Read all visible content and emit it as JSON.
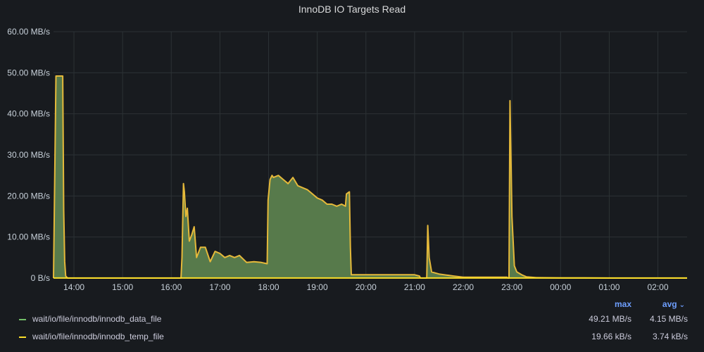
{
  "panel": {
    "title": "InnoDB IO Targets Read"
  },
  "legend": {
    "col_max": "max",
    "col_avg": "avg",
    "sort_icon": "chevron-down-icon",
    "rows": [
      {
        "name": "wait/io/file/innodb/innodb_data_file",
        "max": "49.21 MB/s",
        "avg": "4.15 MB/s",
        "color": "#73bf69"
      },
      {
        "name": "wait/io/file/innodb/innodb_temp_file",
        "max": "19.66 kB/s",
        "avg": "3.74 kB/s",
        "color": "#fade2a"
      }
    ]
  },
  "chart_data": {
    "type": "area",
    "title": "InnoDB IO Targets Read",
    "ylabel": "",
    "xlabel": "",
    "ylim": [
      0,
      60
    ],
    "y_unit": "MB/s",
    "y_ticks": [
      "0 B/s",
      "10.00 MB/s",
      "20.00 MB/s",
      "30.00 MB/s",
      "40.00 MB/s",
      "50.00 MB/s",
      "60.00 MB/s"
    ],
    "y_tick_values": [
      0,
      10,
      20,
      30,
      40,
      50,
      60
    ],
    "x_ticks": [
      "14:00",
      "15:00",
      "16:00",
      "17:00",
      "18:00",
      "19:00",
      "20:00",
      "21:00",
      "22:00",
      "23:00",
      "00:00",
      "01:00",
      "02:00"
    ],
    "xlim_hours": [
      13.58,
      26.6
    ],
    "grid": true,
    "legend_position": "bottom",
    "colors": {
      "data_file_line": "#e5b93a",
      "data_file_fill": "#577a4b",
      "temp_file": "#fade2a"
    },
    "series": [
      {
        "name": "wait/io/file/innodb/innodb_data_file",
        "x": [
          13.58,
          13.63,
          13.65,
          13.77,
          13.79,
          13.81,
          13.83,
          13.87,
          16.0,
          16.2,
          16.22,
          16.25,
          16.27,
          16.3,
          16.33,
          16.37,
          16.42,
          16.47,
          16.52,
          16.6,
          16.7,
          16.8,
          16.9,
          17.0,
          17.1,
          17.2,
          17.3,
          17.4,
          17.55,
          17.7,
          17.85,
          17.97,
          17.99,
          18.03,
          18.07,
          18.1,
          18.2,
          18.3,
          18.4,
          18.5,
          18.6,
          18.7,
          18.8,
          18.9,
          19.0,
          19.1,
          19.2,
          19.3,
          19.4,
          19.5,
          19.58,
          19.6,
          19.66,
          19.68,
          19.7,
          19.75,
          19.8,
          20.0,
          20.5,
          21.0,
          21.1,
          21.12,
          21.2,
          21.25,
          21.27,
          21.3,
          21.35,
          21.5,
          21.8,
          22.0,
          22.5,
          22.9,
          22.92,
          22.94,
          22.96,
          23.0,
          23.05,
          23.1,
          23.2,
          23.3,
          23.5,
          24.0,
          24.5,
          25.0,
          26.0,
          26.6
        ],
        "y": [
          0,
          49.2,
          49.2,
          49.2,
          16.5,
          4.0,
          0.5,
          0,
          0,
          0,
          5.0,
          23.0,
          21.0,
          15.0,
          17.0,
          9.0,
          10.5,
          12.5,
          5.0,
          7.5,
          7.5,
          4.0,
          6.5,
          6.0,
          5.0,
          5.5,
          5.0,
          5.5,
          3.8,
          4.0,
          3.8,
          3.5,
          19.0,
          24.0,
          25.0,
          24.5,
          25.0,
          24.0,
          23.0,
          24.5,
          22.5,
          22.0,
          21.5,
          20.5,
          19.5,
          19.0,
          18.0,
          18.0,
          17.5,
          18.0,
          17.5,
          20.5,
          21.0,
          7.5,
          0.8,
          0.8,
          0.8,
          0.8,
          0.8,
          0.8,
          0.5,
          0,
          0,
          0,
          12.8,
          5.0,
          1.5,
          1.0,
          0.5,
          0.2,
          0.2,
          0.2,
          0,
          0,
          43.2,
          15.0,
          3.0,
          1.5,
          0.8,
          0.3,
          0.1,
          0.05,
          0.05,
          0,
          0,
          0
        ]
      },
      {
        "name": "wait/io/file/innodb/innodb_temp_file",
        "x": [
          13.58,
          26.6
        ],
        "y": [
          0.019,
          0.019
        ]
      }
    ]
  }
}
